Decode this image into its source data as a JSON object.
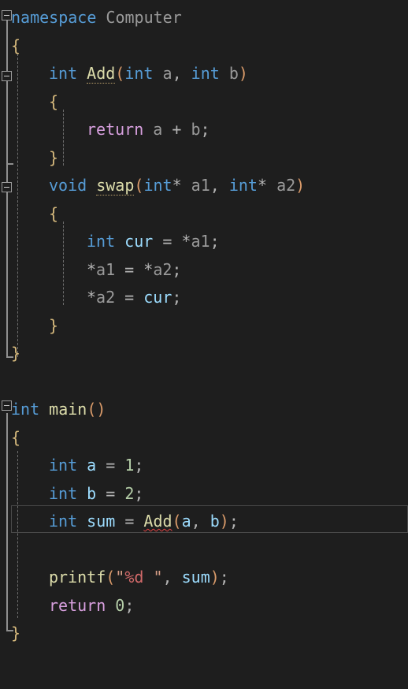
{
  "editor": {
    "background": "#1e1e1e",
    "font_size_px": 20,
    "line_height_px": 35.5,
    "language": "C++",
    "current_line_number": 17
  },
  "colors": {
    "keyword": "#569cd6",
    "control_keyword": "#d8a0df",
    "function": "#dcdcaa",
    "variable": "#9cdcfe",
    "parameter": "#9a9a9a",
    "number": "#b5cea8",
    "string": "#d69d85",
    "format_specifier": "#d16969",
    "operator": "#b4b4b4",
    "brace": "#d7ba7d",
    "bracket_level1": "#da9b6a",
    "error_squiggle": "#e04343",
    "indent_guide": "#6e6e6e",
    "outline_line": "#8f8f8f",
    "current_line_border": "#4a4a4a"
  },
  "outline_toggles": [
    {
      "name": "namespace-Computer",
      "state": "expanded",
      "glyph": "minus"
    },
    {
      "name": "function-Add",
      "state": "expanded",
      "glyph": "minus"
    },
    {
      "name": "function-swap",
      "state": "expanded",
      "glyph": "minus"
    },
    {
      "name": "function-main",
      "state": "expanded",
      "glyph": "minus"
    }
  ],
  "code_text": "namespace Computer\n{\n    int Add(int a, int b)\n    {\n        return a + b;\n    }\n    void swap(int* a1, int* a2)\n    {\n        int cur = *a1;\n        *a1 = *a2;\n        *a2 = cur;\n    }\n}\n\nint main()\n{\n    int a = 1;\n    int b = 2;\n    int sum = Add(a, b);\n\n    printf(\"%d \", sum);\n    return 0;\n}",
  "lines": [
    {
      "n": 1,
      "indent": 0,
      "tokens": [
        {
          "t": "namespace",
          "c": "kw"
        },
        {
          "t": " ",
          "c": "op"
        },
        {
          "t": "Computer",
          "c": "param"
        }
      ]
    },
    {
      "n": 2,
      "indent": 0,
      "tokens": [
        {
          "t": "{",
          "c": "br2"
        }
      ]
    },
    {
      "n": 3,
      "indent": 1,
      "tokens": [
        {
          "t": "int",
          "c": "kw"
        },
        {
          "t": " ",
          "c": "op"
        },
        {
          "t": "Add",
          "c": "fn dotted"
        },
        {
          "t": "(",
          "c": "br1"
        },
        {
          "t": "int",
          "c": "kw"
        },
        {
          "t": " ",
          "c": "op"
        },
        {
          "t": "a",
          "c": "param"
        },
        {
          "t": ", ",
          "c": "op"
        },
        {
          "t": "int",
          "c": "kw"
        },
        {
          "t": " ",
          "c": "op"
        },
        {
          "t": "b",
          "c": "param"
        },
        {
          "t": ")",
          "c": "br1"
        }
      ]
    },
    {
      "n": 4,
      "indent": 1,
      "tokens": [
        {
          "t": "{",
          "c": "br2"
        }
      ]
    },
    {
      "n": 5,
      "indent": 2,
      "tokens": [
        {
          "t": "return",
          "c": "ctl"
        },
        {
          "t": " ",
          "c": "op"
        },
        {
          "t": "a",
          "c": "param"
        },
        {
          "t": " + ",
          "c": "op"
        },
        {
          "t": "b",
          "c": "param"
        },
        {
          "t": ";",
          "c": "op"
        }
      ]
    },
    {
      "n": 6,
      "indent": 1,
      "tokens": [
        {
          "t": "}",
          "c": "br2"
        }
      ]
    },
    {
      "n": 7,
      "indent": 1,
      "tokens": [
        {
          "t": "void",
          "c": "kw"
        },
        {
          "t": " ",
          "c": "op"
        },
        {
          "t": "swap",
          "c": "fn dotted"
        },
        {
          "t": "(",
          "c": "br1"
        },
        {
          "t": "int",
          "c": "kw"
        },
        {
          "t": "*",
          "c": "op"
        },
        {
          "t": " ",
          "c": "op"
        },
        {
          "t": "a1",
          "c": "param"
        },
        {
          "t": ", ",
          "c": "op"
        },
        {
          "t": "int",
          "c": "kw"
        },
        {
          "t": "*",
          "c": "op"
        },
        {
          "t": " ",
          "c": "op"
        },
        {
          "t": "a2",
          "c": "param"
        },
        {
          "t": ")",
          "c": "br1"
        }
      ]
    },
    {
      "n": 8,
      "indent": 1,
      "tokens": [
        {
          "t": "{",
          "c": "br2"
        }
      ]
    },
    {
      "n": 9,
      "indent": 2,
      "tokens": [
        {
          "t": "int",
          "c": "kw"
        },
        {
          "t": " ",
          "c": "op"
        },
        {
          "t": "cur",
          "c": "var"
        },
        {
          "t": " = ",
          "c": "op"
        },
        {
          "t": "*",
          "c": "op"
        },
        {
          "t": "a1",
          "c": "param"
        },
        {
          "t": ";",
          "c": "op"
        }
      ]
    },
    {
      "n": 10,
      "indent": 2,
      "tokens": [
        {
          "t": "*",
          "c": "op"
        },
        {
          "t": "a1",
          "c": "param"
        },
        {
          "t": " = ",
          "c": "op"
        },
        {
          "t": "*",
          "c": "op"
        },
        {
          "t": "a2",
          "c": "param"
        },
        {
          "t": ";",
          "c": "op"
        }
      ]
    },
    {
      "n": 11,
      "indent": 2,
      "tokens": [
        {
          "t": "*",
          "c": "op"
        },
        {
          "t": "a2",
          "c": "param"
        },
        {
          "t": " = ",
          "c": "op"
        },
        {
          "t": "cur",
          "c": "var"
        },
        {
          "t": ";",
          "c": "op"
        }
      ]
    },
    {
      "n": 12,
      "indent": 1,
      "tokens": [
        {
          "t": "}",
          "c": "br2"
        }
      ]
    },
    {
      "n": 13,
      "indent": 0,
      "tokens": [
        {
          "t": "}",
          "c": "br2"
        }
      ]
    },
    {
      "n": 14,
      "indent": 0,
      "tokens": []
    },
    {
      "n": 15,
      "indent": 0,
      "tokens": [
        {
          "t": "int",
          "c": "kw"
        },
        {
          "t": " ",
          "c": "op"
        },
        {
          "t": "main",
          "c": "fn"
        },
        {
          "t": "(",
          "c": "br1"
        },
        {
          "t": ")",
          "c": "br1"
        }
      ]
    },
    {
      "n": 16,
      "indent": 0,
      "tokens": [
        {
          "t": "{",
          "c": "br2"
        }
      ]
    },
    {
      "n": 17,
      "indent": 1,
      "tokens": [
        {
          "t": "int",
          "c": "kw"
        },
        {
          "t": " ",
          "c": "op"
        },
        {
          "t": "a",
          "c": "var"
        },
        {
          "t": " = ",
          "c": "op"
        },
        {
          "t": "1",
          "c": "num"
        },
        {
          "t": ";",
          "c": "op"
        }
      ]
    },
    {
      "n": 18,
      "indent": 1,
      "tokens": [
        {
          "t": "int",
          "c": "kw"
        },
        {
          "t": " ",
          "c": "op"
        },
        {
          "t": "b",
          "c": "var"
        },
        {
          "t": " = ",
          "c": "op"
        },
        {
          "t": "2",
          "c": "num"
        },
        {
          "t": ";",
          "c": "op"
        }
      ]
    },
    {
      "n": 19,
      "indent": 1,
      "current": true,
      "tokens": [
        {
          "t": "int",
          "c": "kw"
        },
        {
          "t": " ",
          "c": "op"
        },
        {
          "t": "sum",
          "c": "var"
        },
        {
          "t": " = ",
          "c": "op"
        },
        {
          "t": "Add",
          "c": "fn sq"
        },
        {
          "t": "(",
          "c": "br1"
        },
        {
          "t": "a",
          "c": "var"
        },
        {
          "t": ", ",
          "c": "op"
        },
        {
          "t": "b",
          "c": "var"
        },
        {
          "t": ")",
          "c": "br1"
        },
        {
          "t": ";",
          "c": "op"
        }
      ]
    },
    {
      "n": 20,
      "indent": 1,
      "tokens": []
    },
    {
      "n": 21,
      "indent": 1,
      "tokens": [
        {
          "t": "printf",
          "c": "fn"
        },
        {
          "t": "(",
          "c": "br1"
        },
        {
          "t": "\"",
          "c": "str"
        },
        {
          "t": "%d",
          "c": "fmt"
        },
        {
          "t": " \"",
          "c": "str"
        },
        {
          "t": ", ",
          "c": "op"
        },
        {
          "t": "sum",
          "c": "var"
        },
        {
          "t": ")",
          "c": "br1"
        },
        {
          "t": ";",
          "c": "op"
        }
      ]
    },
    {
      "n": 22,
      "indent": 1,
      "tokens": [
        {
          "t": "return",
          "c": "ctl"
        },
        {
          "t": " ",
          "c": "op"
        },
        {
          "t": "0",
          "c": "num"
        },
        {
          "t": ";",
          "c": "op"
        }
      ]
    },
    {
      "n": 23,
      "indent": 0,
      "tokens": [
        {
          "t": "}",
          "c": "br2"
        }
      ]
    }
  ]
}
